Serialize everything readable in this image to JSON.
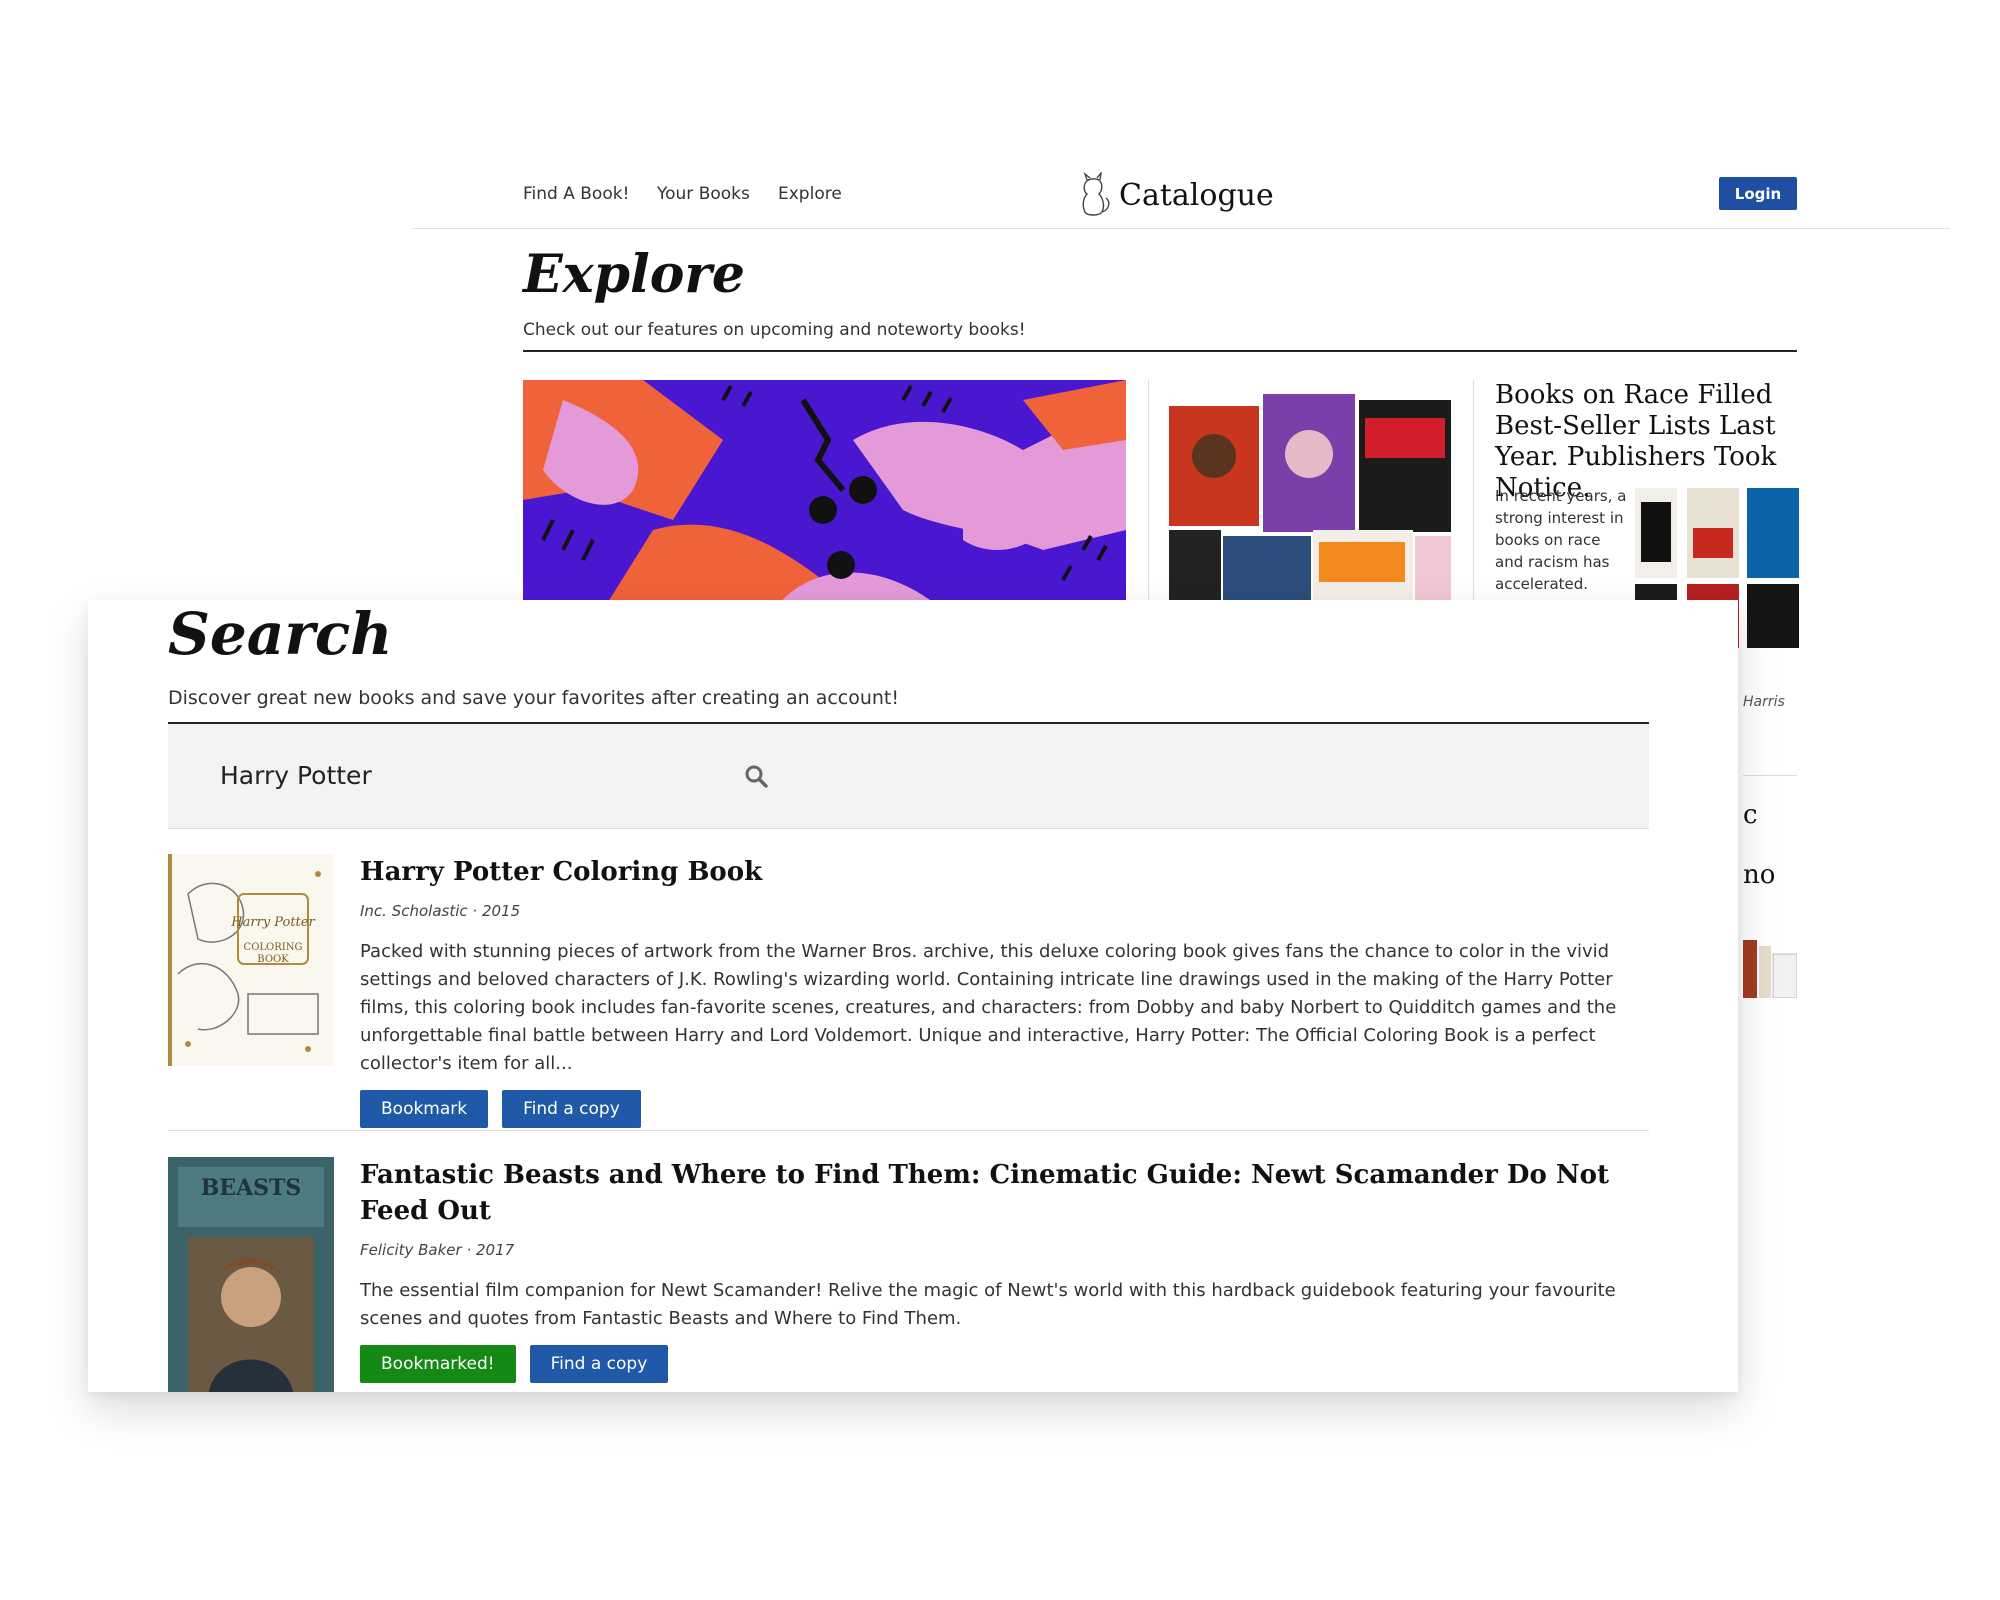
{
  "explore_page": {
    "nav": {
      "links": [
        "Find A Book!",
        "Your Books",
        "Explore"
      ],
      "brand": "Catalogue",
      "login_label": "Login"
    },
    "title": "Explore",
    "subtitle": "Check out our features on upcoming and noteworty books!",
    "side_feature": {
      "headline": "Books on Race Filled Best-Seller Lists Last Year. Publishers Took Notice.",
      "excerpt": "In recent years, a strong interest in books on race and racism has accelerated.",
      "author_fragment": "Harris",
      "heading_fragment_1": "c",
      "heading_fragment_2": "no"
    }
  },
  "search_page": {
    "title": "Search",
    "subtitle": "Discover great new books and save your favorites after creating an account!",
    "search": {
      "value": "Harry Potter"
    },
    "results": [
      {
        "title": "Harry Potter Coloring Book",
        "meta": "Inc. Scholastic · 2015",
        "description": "Packed with stunning pieces of artwork from the Warner Bros. archive, this deluxe coloring book gives fans the chance to color in the vivid settings and beloved characters of J.K. Rowling's wizarding world. Containing intricate line drawings used in the making of the Harry Potter films, this coloring book includes fan-favorite scenes, creatures, and characters: from Dobby and baby Norbert to Quidditch games and the unforgettable final battle between Harry and Lord Voldemort. Unique and interactive, Harry Potter: The Official Coloring Book is a perfect collector's item for all...",
        "bookmark_label": "Bookmark",
        "find_label": "Find a copy"
      },
      {
        "title": "Fantastic Beasts and Where to Find Them: Cinematic Guide: Newt Scamander Do Not Feed Out",
        "meta": "Felicity Baker · 2017",
        "description": "The essential film companion for Newt Scamander! Relive the magic of Newt's world with this hardback guidebook featuring your favourite scenes and quotes from Fantastic Beasts and Where to Find Them.",
        "bookmark_label": "Bookmarked!",
        "find_label": "Find a copy"
      }
    ]
  },
  "colors": {
    "primary_blue": "#2059a8",
    "bookmarked_green": "#148a14",
    "art_purple": "#4a17d1",
    "art_orange": "#f0623a",
    "art_pink": "#e49ad9"
  }
}
